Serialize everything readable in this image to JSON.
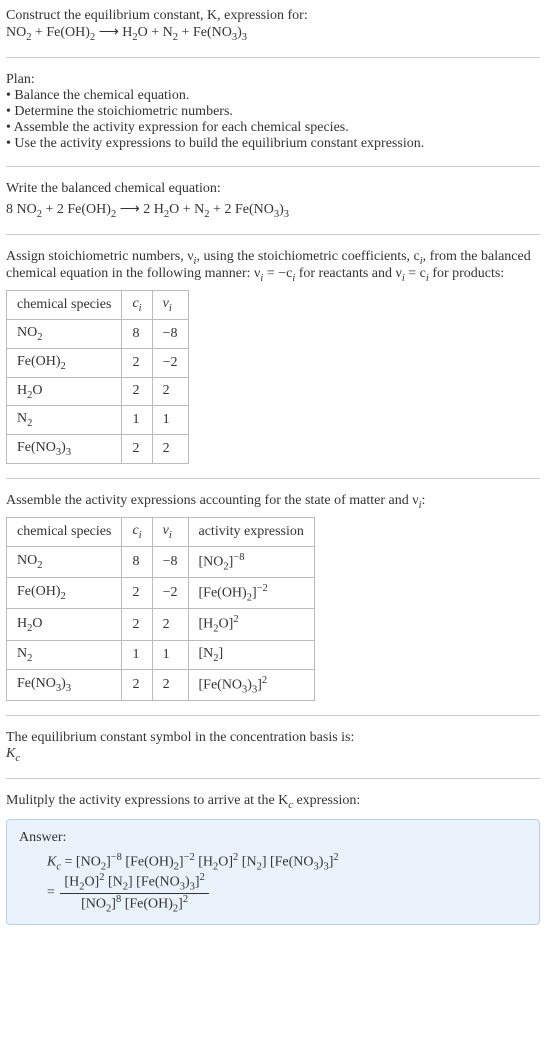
{
  "intro": {
    "line1": "Construct the equilibrium constant, K, expression for:",
    "equation_lhs_1": "NO",
    "equation_lhs_1_sub": "2",
    "equation_plus": " + ",
    "equation_lhs_2": "Fe(OH)",
    "equation_lhs_2_sub": "2",
    "arrow": " ⟶ ",
    "equation_rhs_1": "H",
    "equation_rhs_1_sub": "2",
    "equation_rhs_1b": "O",
    "equation_rhs_2": "N",
    "equation_rhs_2_sub": "2",
    "equation_rhs_3": "Fe(NO",
    "equation_rhs_3_sub": "3",
    "equation_rhs_3b": ")",
    "equation_rhs_3_sub2": "3"
  },
  "plan": {
    "heading": "Plan:",
    "b1": "• Balance the chemical equation.",
    "b2": "• Determine the stoichiometric numbers.",
    "b3": "• Assemble the activity expression for each chemical species.",
    "b4": "• Use the activity expressions to build the equilibrium constant expression."
  },
  "balanced": {
    "heading": "Write the balanced chemical equation:",
    "c1": "8 ",
    "s1": "NO",
    "s1sub": "2",
    "c2": " + 2 ",
    "s2": "Fe(OH)",
    "s2sub": "2",
    "arrow": " ⟶ ",
    "c3": "2 ",
    "s3": "H",
    "s3sub": "2",
    "s3b": "O",
    "plus": " + ",
    "s4": "N",
    "s4sub": "2",
    "c5": " + 2 ",
    "s5": "Fe(NO",
    "s5sub": "3",
    "s5b": ")",
    "s5sub2": "3"
  },
  "stoich_intro": {
    "part1": "Assign stoichiometric numbers, ν",
    "sub_i1": "i",
    "part2": ", using the stoichiometric coefficients, c",
    "sub_i2": "i",
    "part3": ", from the balanced chemical equation in the following manner: ν",
    "sub_i3": "i",
    "part4": " = −c",
    "sub_i4": "i",
    "part5": " for reactants and ν",
    "sub_i5": "i",
    "part6": " = c",
    "sub_i6": "i",
    "part7": " for products:"
  },
  "table1": {
    "h1": "chemical species",
    "h2_a": "c",
    "h2_b": "i",
    "h3_a": "ν",
    "h3_b": "i",
    "rows": [
      {
        "sp_a": "NO",
        "sp_sub": "2",
        "sp_b": "",
        "sp_sub2": "",
        "c": "8",
        "v": "−8"
      },
      {
        "sp_a": "Fe(OH)",
        "sp_sub": "2",
        "sp_b": "",
        "sp_sub2": "",
        "c": "2",
        "v": "−2"
      },
      {
        "sp_a": "H",
        "sp_sub": "2",
        "sp_b": "O",
        "sp_sub2": "",
        "c": "2",
        "v": "2"
      },
      {
        "sp_a": "N",
        "sp_sub": "2",
        "sp_b": "",
        "sp_sub2": "",
        "c": "1",
        "v": "1"
      },
      {
        "sp_a": "Fe(NO",
        "sp_sub": "3",
        "sp_b": ")",
        "sp_sub2": "3",
        "c": "2",
        "v": "2"
      }
    ]
  },
  "activity_intro": {
    "part1": "Assemble the activity expressions accounting for the state of matter and ν",
    "sub": "i",
    "part2": ":"
  },
  "table2": {
    "h1": "chemical species",
    "h2_a": "c",
    "h2_b": "i",
    "h3_a": "ν",
    "h3_b": "i",
    "h4": "activity expression",
    "rows": [
      {
        "sp_a": "NO",
        "sp_sub": "2",
        "sp_b": "",
        "sp_sub2": "",
        "c": "8",
        "v": "−8",
        "ae_a": "[NO",
        "ae_sub": "2",
        "ae_b": "]",
        "ae_sup": "−8",
        "ae_c": "",
        "ae_sub2": "",
        "ae_d": "",
        "ae_sup2": ""
      },
      {
        "sp_a": "Fe(OH)",
        "sp_sub": "2",
        "sp_b": "",
        "sp_sub2": "",
        "c": "2",
        "v": "−2",
        "ae_a": "[Fe(OH)",
        "ae_sub": "2",
        "ae_b": "]",
        "ae_sup": "−2",
        "ae_c": "",
        "ae_sub2": "",
        "ae_d": "",
        "ae_sup2": ""
      },
      {
        "sp_a": "H",
        "sp_sub": "2",
        "sp_b": "O",
        "sp_sub2": "",
        "c": "2",
        "v": "2",
        "ae_a": "[H",
        "ae_sub": "2",
        "ae_b": "O]",
        "ae_sup": "2",
        "ae_c": "",
        "ae_sub2": "",
        "ae_d": "",
        "ae_sup2": ""
      },
      {
        "sp_a": "N",
        "sp_sub": "2",
        "sp_b": "",
        "sp_sub2": "",
        "c": "1",
        "v": "1",
        "ae_a": "[N",
        "ae_sub": "2",
        "ae_b": "]",
        "ae_sup": "",
        "ae_c": "",
        "ae_sub2": "",
        "ae_d": "",
        "ae_sup2": ""
      },
      {
        "sp_a": "Fe(NO",
        "sp_sub": "3",
        "sp_b": ")",
        "sp_sub2": "3",
        "c": "2",
        "v": "2",
        "ae_a": "[Fe(NO",
        "ae_sub": "3",
        "ae_b": ")",
        "ae_sup": "",
        "ae_c": "",
        "ae_sub2": "3",
        "ae_d": "]",
        "ae_sup2": "2"
      }
    ]
  },
  "symbol_intro": "The equilibrium constant symbol in the concentration basis is:",
  "symbol": {
    "K": "K",
    "c": "c"
  },
  "multiply_intro": {
    "part1": "Mulitply the activity expressions to arrive at the K",
    "sub": "c",
    "part2": " expression:"
  },
  "answer": {
    "label": "Answer:",
    "lhs_K": "K",
    "lhs_c": "c",
    "eq": " = ",
    "t1_a": "[NO",
    "t1_sub": "2",
    "t1_b": "]",
    "t1_sup": "−8",
    "sp": " ",
    "t2_a": "[Fe(OH)",
    "t2_sub": "2",
    "t2_b": "]",
    "t2_sup": "−2",
    "t3_a": "[H",
    "t3_sub": "2",
    "t3_b": "O]",
    "t3_sup": "2",
    "t4_a": "[N",
    "t4_sub": "2",
    "t4_b": "]",
    "t5_a": "[Fe(NO",
    "t5_sub": "3",
    "t5_b": ")",
    "t5_sub2": "3",
    "t5_c": "]",
    "t5_sup": "2",
    "eq2": "= ",
    "num_t1_a": "[H",
    "num_t1_sub": "2",
    "num_t1_b": "O]",
    "num_t1_sup": "2",
    "num_t2_a": "[N",
    "num_t2_sub": "2",
    "num_t2_b": "]",
    "num_t3_a": "[Fe(NO",
    "num_t3_sub": "3",
    "num_t3_b": ")",
    "num_t3_sub2": "3",
    "num_t3_c": "]",
    "num_t3_sup": "2",
    "den_t1_a": "[NO",
    "den_t1_sub": "2",
    "den_t1_b": "]",
    "den_t1_sup": "8",
    "den_t2_a": "[Fe(OH)",
    "den_t2_sub": "2",
    "den_t2_b": "]",
    "den_t2_sup": "2"
  }
}
